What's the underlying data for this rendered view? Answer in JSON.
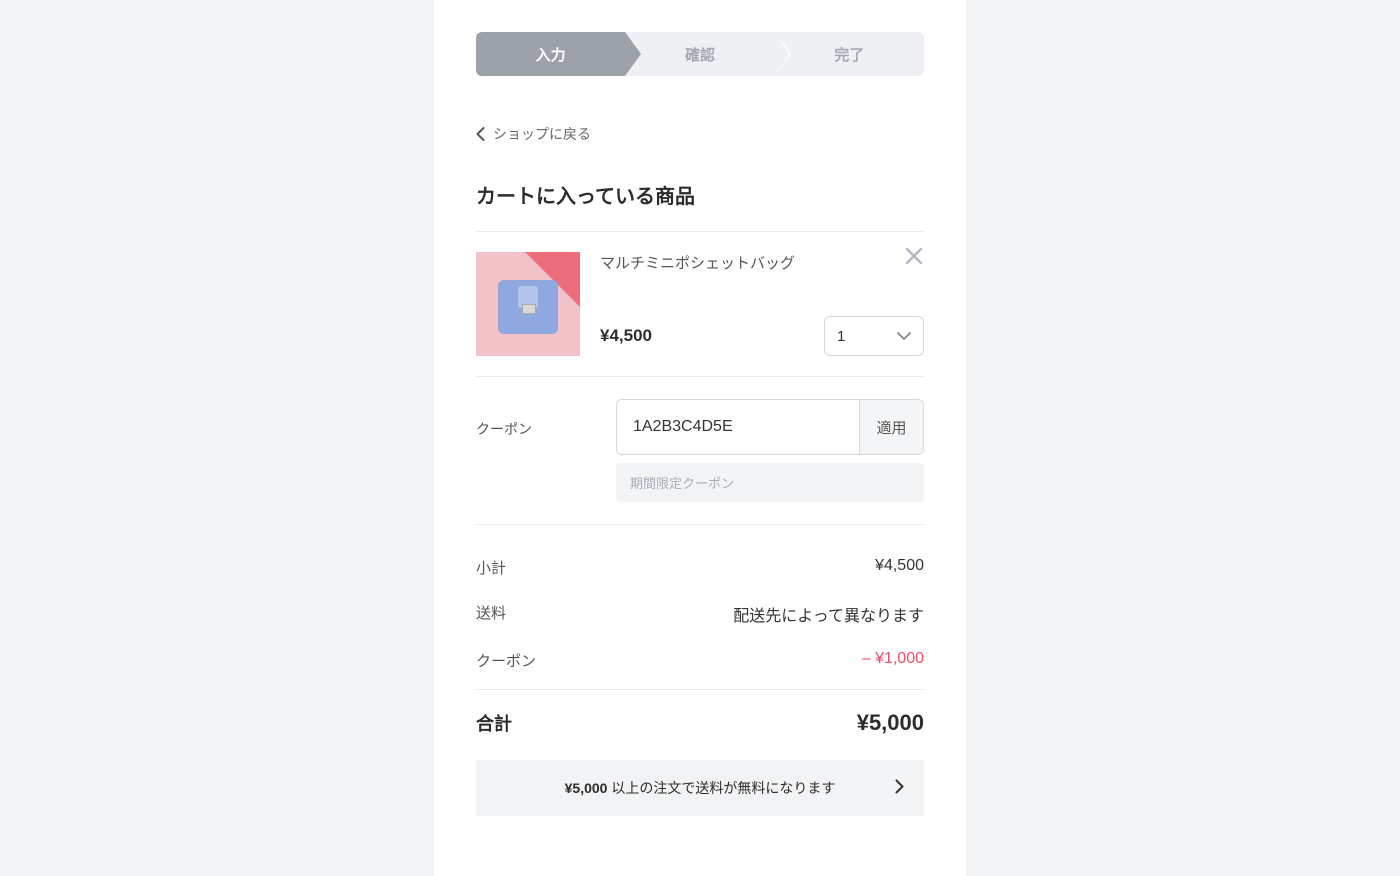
{
  "progress": {
    "steps": [
      "入力",
      "確認",
      "完了"
    ]
  },
  "back_link": {
    "label": "ショップに戻る"
  },
  "cart": {
    "title": "カートに入っている商品",
    "items": [
      {
        "name": "マルチミニポシェットバッグ",
        "price": "¥4,500",
        "qty": "1"
      }
    ]
  },
  "coupon": {
    "label": "クーポン",
    "code": "1A2B3C4D5E",
    "apply_label": "適用",
    "note": "期間限定クーポン"
  },
  "summary": {
    "subtotal_label": "小計",
    "subtotal_value": "¥4,500",
    "shipping_label": "送料",
    "shipping_value": "配送先によって異なります",
    "coupon_label": "クーポン",
    "coupon_value": "– ¥1,000"
  },
  "total": {
    "label": "合計",
    "value": "¥5,000"
  },
  "shipping_banner": {
    "bold": "¥5,000",
    "text": " 以上の注文で送料が無料になります"
  }
}
